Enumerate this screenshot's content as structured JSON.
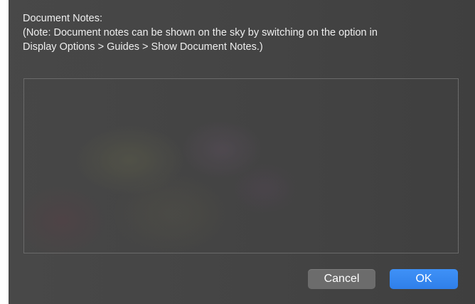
{
  "dialog": {
    "title": "Document Notes:",
    "note_line_1": "(Note: Document notes can be shown on the sky by switching on the option in",
    "note_line_2": "Display Options > Guides > Show Document Notes.)",
    "notes_value": "",
    "cancel_label": "Cancel",
    "ok_label": "OK"
  },
  "colors": {
    "background": "#434343",
    "primary_button": "#3486f0",
    "secondary_button": "#6c6c6c",
    "text": "#eeeeee"
  }
}
